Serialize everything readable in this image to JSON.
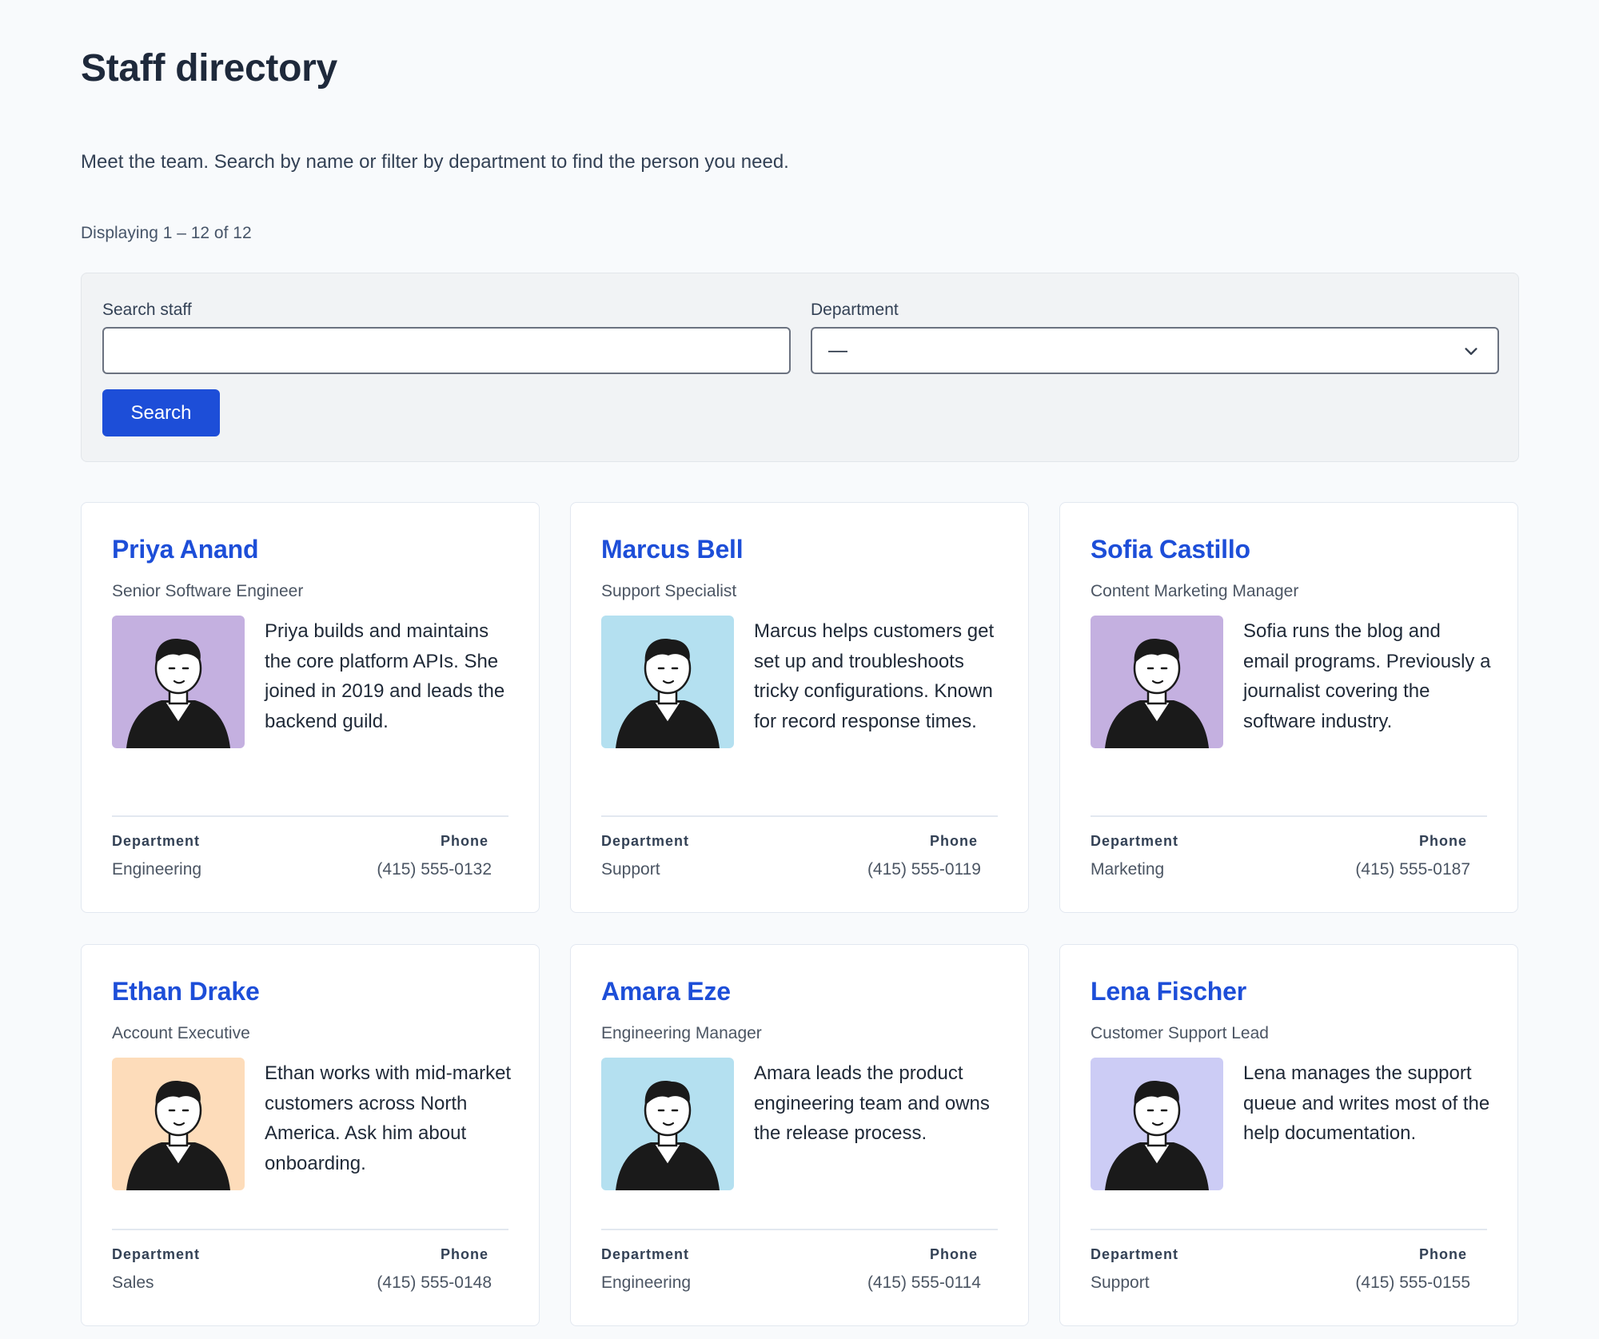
{
  "page": {
    "title": "Staff directory",
    "intro": "Meet the team. Search by name or filter by department to find the person you need.",
    "count": "Displaying 1 – 12 of 12"
  },
  "filters": {
    "search_label": "Search staff",
    "search_value": "",
    "department_label": "Department",
    "department_selected": "—",
    "search_button": "Search"
  },
  "labels": {
    "department": "Department",
    "phone": "Phone"
  },
  "staff": [
    {
      "name": "Priya Anand",
      "role": "Senior Software Engineer",
      "bio": "Priya builds and maintains the core platform APIs. She joined in 2019 and leads the backend guild.",
      "department": "Engineering",
      "phone": "(415) 555-0132",
      "avatar_bg": "#c4b0e0",
      "avatar_icon": "person-avatar-icon"
    },
    {
      "name": "Marcus Bell",
      "role": "Support Specialist",
      "bio": "Marcus helps customers get set up and troubleshoots tricky configurations. Known for record response times.",
      "department": "Support",
      "phone": "(415) 555-0119",
      "avatar_bg": "#b4e0f0",
      "avatar_icon": "person-avatar-icon"
    },
    {
      "name": "Sofia Castillo",
      "role": "Content Marketing Manager",
      "bio": "Sofia runs the blog and email programs. Previously a journalist covering the software industry.",
      "department": "Marketing",
      "phone": "(415) 555-0187",
      "avatar_bg": "#c4b0e0",
      "avatar_icon": "person-avatar-icon"
    },
    {
      "name": "Ethan Drake",
      "role": "Account Executive",
      "bio": "Ethan works with mid-market customers across North America. Ask him about onboarding.",
      "department": "Sales",
      "phone": "(415) 555-0148",
      "avatar_bg": "#fddcba",
      "avatar_icon": "person-avatar-icon"
    },
    {
      "name": "Amara Eze",
      "role": "Engineering Manager",
      "bio": "Amara leads the product engineering team and owns the release process.",
      "department": "Engineering",
      "phone": "(415) 555-0114",
      "avatar_bg": "#b4e0f0",
      "avatar_icon": "person-avatar-icon"
    },
    {
      "name": "Lena Fischer",
      "role": "Customer Support Lead",
      "bio": "Lena manages the support queue and writes most of the help documentation.",
      "department": "Support",
      "phone": "(415) 555-0155",
      "avatar_bg": "#ccccf5",
      "avatar_icon": "person-avatar-icon"
    }
  ],
  "colors": {
    "accent": "#1d4ed8",
    "background": "#f8fafc"
  }
}
